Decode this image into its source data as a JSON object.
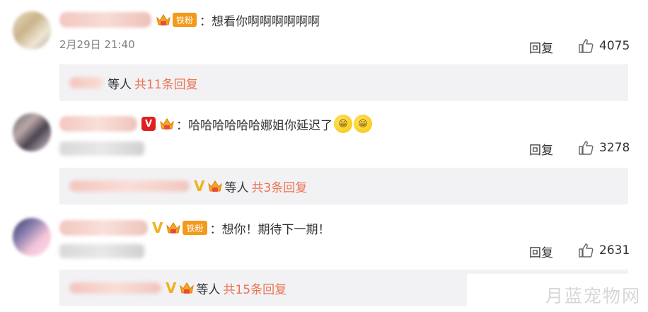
{
  "comments": [
    {
      "text": "：想看你啊啊啊啊啊啊",
      "fan_badge": "铁粉",
      "timestamp": "2月29日 21:40",
      "reply_label": "回复",
      "likes": "4075",
      "sub_replies": {
        "deng": "等人",
        "more": "共11条回复"
      }
    },
    {
      "text": "：哈哈哈哈哈哈娜姐你延迟了",
      "timestamp": "",
      "reply_label": "回复",
      "likes": "3278",
      "sub_replies": {
        "deng": "等人",
        "more": "共3条回复"
      }
    },
    {
      "text": "：想你！期待下一期！",
      "fan_badge": "铁粉",
      "timestamp": "",
      "reply_label": "回复",
      "likes": "2631",
      "sub_replies": {
        "deng": "等人",
        "more": "共15条回复"
      }
    }
  ],
  "watermark": "月蓝宠物网",
  "colors": {
    "link": "#eb7350",
    "sub_bg": "#f2f2f5",
    "vip_red": "#e02020",
    "fan_orange": "#f39a1a",
    "v_gold": "#f2b01e"
  }
}
